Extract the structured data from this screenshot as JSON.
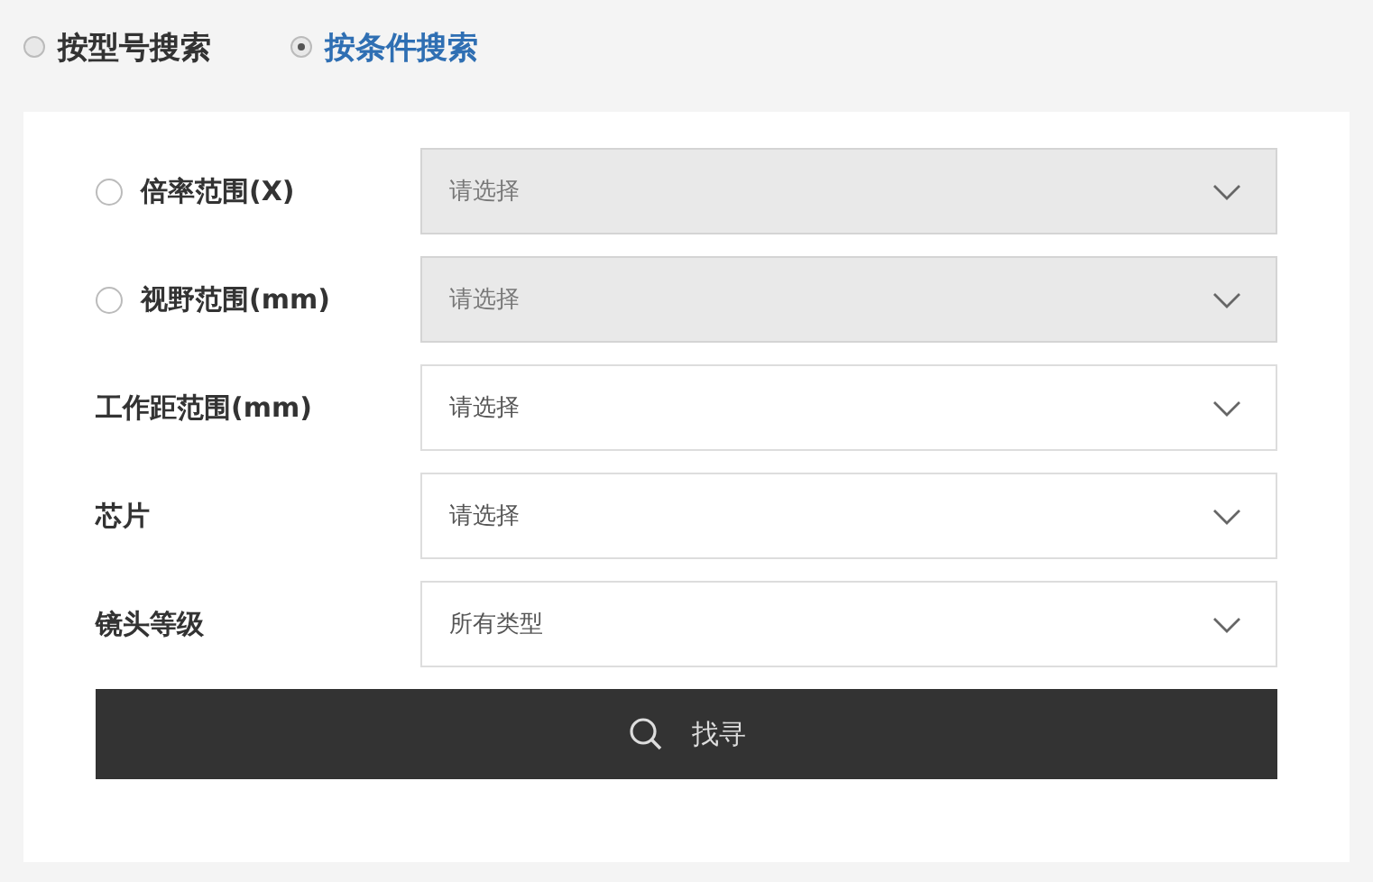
{
  "search_modes": [
    {
      "label": "按型号搜索",
      "selected": false
    },
    {
      "label": "按条件搜索",
      "selected": true
    }
  ],
  "filters": [
    {
      "kind": "radio",
      "label": "倍率范围(X)",
      "checked": false,
      "disabled": true,
      "value": "请选择"
    },
    {
      "kind": "radio",
      "label": "视野范围(mm)",
      "checked": false,
      "disabled": true,
      "value": "请选择"
    },
    {
      "kind": "plain",
      "label": "工作距范围(mm)",
      "disabled": false,
      "value": "请选择"
    },
    {
      "kind": "plain",
      "label": "芯片",
      "disabled": false,
      "value": "请选择"
    },
    {
      "kind": "plain",
      "label": "镜头等级",
      "disabled": false,
      "value": "所有类型"
    }
  ],
  "search_button": {
    "label": "找寻"
  }
}
